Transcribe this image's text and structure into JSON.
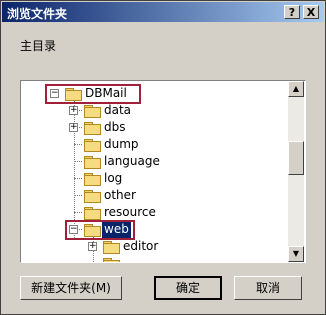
{
  "window": {
    "title": "浏览文件夹",
    "help_label": "?",
    "close_label": "X"
  },
  "prompt": "主目录",
  "tree": {
    "items": [
      {
        "label": "DBMail",
        "expander": "−"
      },
      {
        "label": "data",
        "expander": "+"
      },
      {
        "label": "dbs",
        "expander": "+"
      },
      {
        "label": "dump",
        "expander": ""
      },
      {
        "label": "language",
        "expander": ""
      },
      {
        "label": "log",
        "expander": ""
      },
      {
        "label": "other",
        "expander": ""
      },
      {
        "label": "resource",
        "expander": ""
      },
      {
        "label": "web",
        "expander": "−"
      },
      {
        "label": "editor",
        "expander": "+"
      }
    ]
  },
  "scrollbar": {
    "up_icon": "▲",
    "down_icon": "▼"
  },
  "buttons": {
    "new_folder": "新建文件夹(M)",
    "ok": "确定",
    "cancel": "取消"
  }
}
